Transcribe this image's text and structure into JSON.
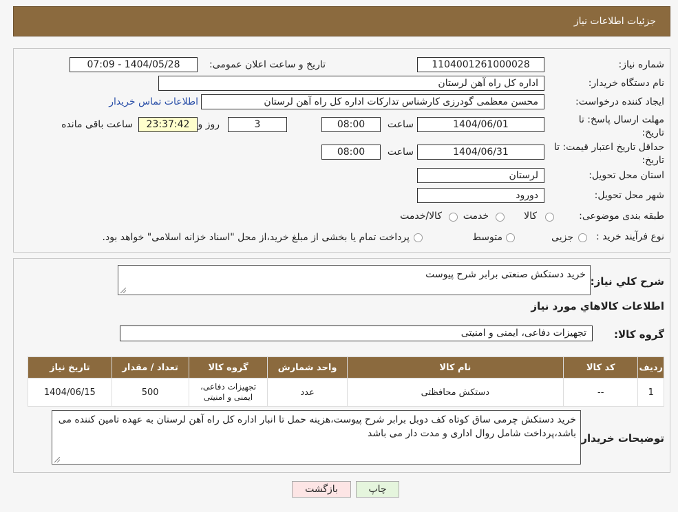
{
  "header": {
    "title": "جزئیات اطلاعات نیاز"
  },
  "form": {
    "need_number_label": "شماره نیاز:",
    "need_number": "1104001261000028",
    "announce_label": "تاریخ و ساعت اعلان عمومی:",
    "announce_value": "1404/05/28 - 07:09",
    "buyer_org_label": "نام دستگاه خریدار:",
    "buyer_org": "اداره کل راه آهن لرستان",
    "requester_label": "ایجاد کننده درخواست:",
    "requester": "محسن معظمی گودرزی کارشناس تدارکات اداره کل راه آهن لرستان",
    "contact_link": "اطلاعات تماس خریدار",
    "deadline_label": "مهلت ارسال پاسخ: تا تاریخ:",
    "deadline_date": "1404/06/01",
    "time_label": "ساعت",
    "deadline_time": "08:00",
    "days_value": "3",
    "days_label": "روز و",
    "remaining_time": "23:37:42",
    "remaining_label": "ساعت باقی مانده",
    "validity_label": "حداقل تاریخ اعتبار قیمت: تا تاریخ:",
    "validity_date": "1404/06/31",
    "validity_time": "08:00",
    "province_label": "استان محل تحویل:",
    "province": "لرستان",
    "city_label": "شهر محل تحویل:",
    "city": "دورود",
    "category_label": "طبقه بندی موضوعی:",
    "category_options": [
      "کالا",
      "خدمت",
      "کالا/خدمت"
    ],
    "process_label": "نوع فرآیند خرید :",
    "process_options": [
      "جزیی",
      "متوسط"
    ],
    "process_note": "پرداخت تمام یا بخشی از مبلغ خرید،از محل \"اسناد خزانه اسلامی\" خواهد بود."
  },
  "details": {
    "summary_label": "شرح کلي نياز:",
    "summary": "خرید دستکش صنعتی برابر شرح پیوست",
    "goods_info_title": "اطلاعات کالاهاي مورد نياز",
    "goods_group_label": "گروه کالا:",
    "goods_group": "تجهیزات دفاعی، ایمنی و امنیتی",
    "columns": [
      "ردیف",
      "کد کالا",
      "نام کالا",
      "واحد شمارش",
      "گروه کالا",
      "تعداد / مقدار",
      "تاریخ نیاز"
    ],
    "rows": [
      {
        "row": "1",
        "code": "--",
        "name": "دستکش محافظتی",
        "unit": "عدد",
        "group": "تجهیزات دفاعی، ایمنی و امنیتی",
        "qty": "500",
        "date": "1404/06/15"
      }
    ],
    "buyer_notes_label": "توضیحات خریدار:",
    "buyer_notes": "خرید دستکش چرمی ساق کوتاه کف دوبل برابر شرح پیوست،هزینه حمل تا انبار اداره کل راه آهن لرستان به عهده تامین کننده می باشد،پرداخت شامل روال اداری و مدت دار می باشد"
  },
  "buttons": {
    "print": "چاپ",
    "back": "بازگشت"
  },
  "colors": {
    "header": "#8b6a3e",
    "back_button": "#fde5e5",
    "print_button": "#e5f5dd"
  }
}
